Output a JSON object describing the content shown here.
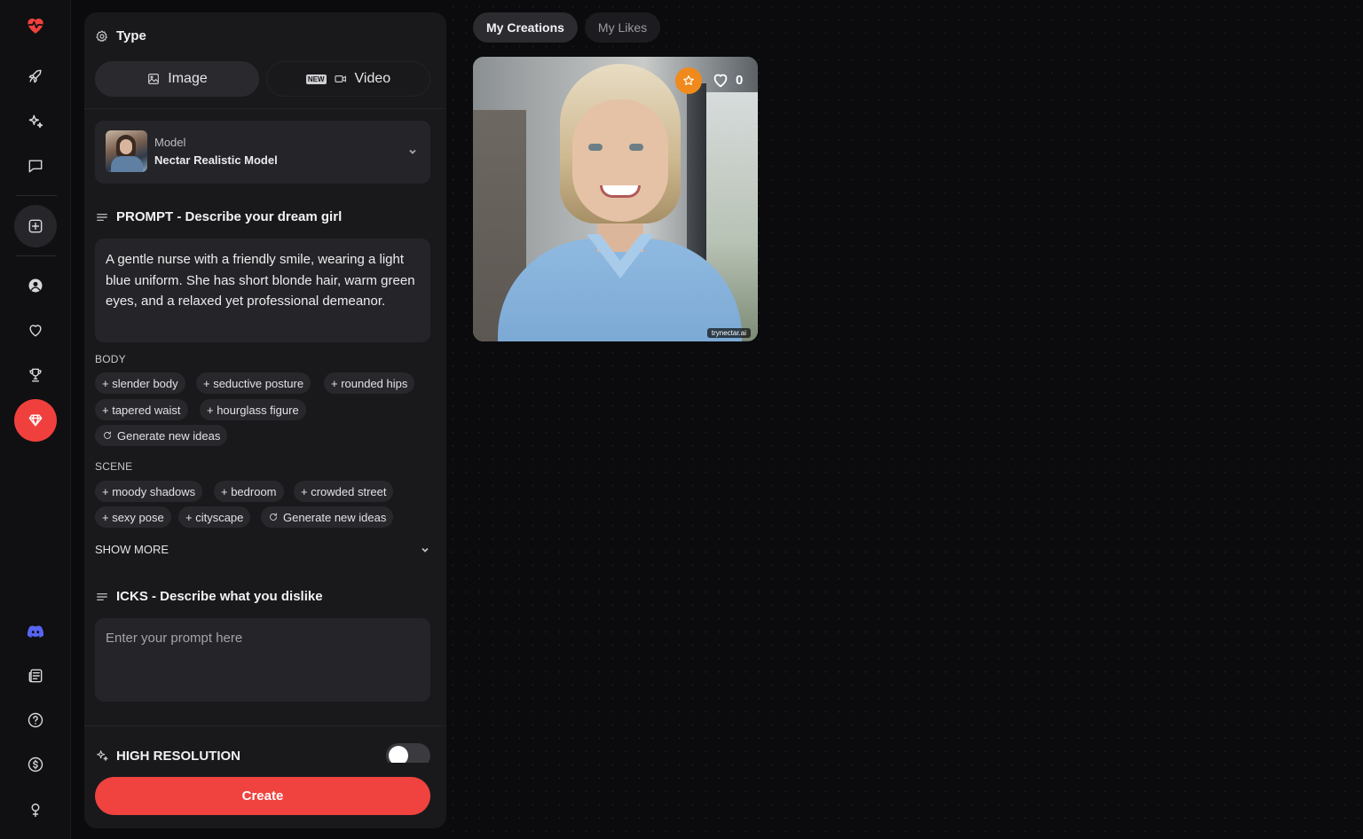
{
  "sidebar": {
    "icons": [
      {
        "name": "logo-heart-icon"
      },
      {
        "name": "rocket-icon"
      },
      {
        "name": "sparkles-icon"
      },
      {
        "name": "chat-icon"
      },
      {
        "name": "create-plus-icon"
      },
      {
        "name": "profile-icon"
      },
      {
        "name": "heart-icon"
      },
      {
        "name": "trophy-icon"
      },
      {
        "name": "diamond-icon"
      },
      {
        "name": "discord-icon"
      },
      {
        "name": "news-icon"
      },
      {
        "name": "help-icon"
      },
      {
        "name": "dollar-icon"
      },
      {
        "name": "gender-icon"
      }
    ],
    "brand_color": "#f0403d"
  },
  "panel": {
    "type_title": "Type",
    "tabs": [
      {
        "label": "Image",
        "selected": true
      },
      {
        "label": "Video",
        "selected": false,
        "badge": "NEW"
      }
    ],
    "model": {
      "label": "Model",
      "value": "Nectar Realistic Model"
    },
    "prompt": {
      "title": "PROMPT - Describe your dream girl",
      "text": "A gentle nurse with a friendly smile, wearing a light blue uniform. She has short blonde hair, warm green eyes, and a relaxed yet professional demeanor."
    },
    "body": {
      "label": "BODY",
      "chips": [
        "+ slender body",
        "+ seductive posture",
        "+ rounded hips",
        "+ tapered waist",
        "+ hourglass figure"
      ],
      "regen": "Generate new ideas"
    },
    "scene": {
      "label": "SCENE",
      "chips": [
        "+ moody shadows",
        "+ bedroom",
        "+ crowded street",
        "+ sexy pose",
        "+ cityscape"
      ],
      "regen": "Generate new ideas"
    },
    "show_more": "SHOW MORE",
    "icks": {
      "title": "ICKS - Describe what you dislike",
      "placeholder": "Enter your prompt here"
    },
    "high_resolution": {
      "label": "HIGH RESOLUTION",
      "enabled": false
    },
    "create_label": "Create",
    "create_color": "#f0433f"
  },
  "main": {
    "tabs": [
      {
        "label": "My Creations",
        "selected": true
      },
      {
        "label": "My Likes",
        "selected": false
      }
    ],
    "creations": [
      {
        "likes": "0",
        "watermark": "trynectar.ai",
        "favorite_color": "#f08a1c"
      }
    ]
  }
}
